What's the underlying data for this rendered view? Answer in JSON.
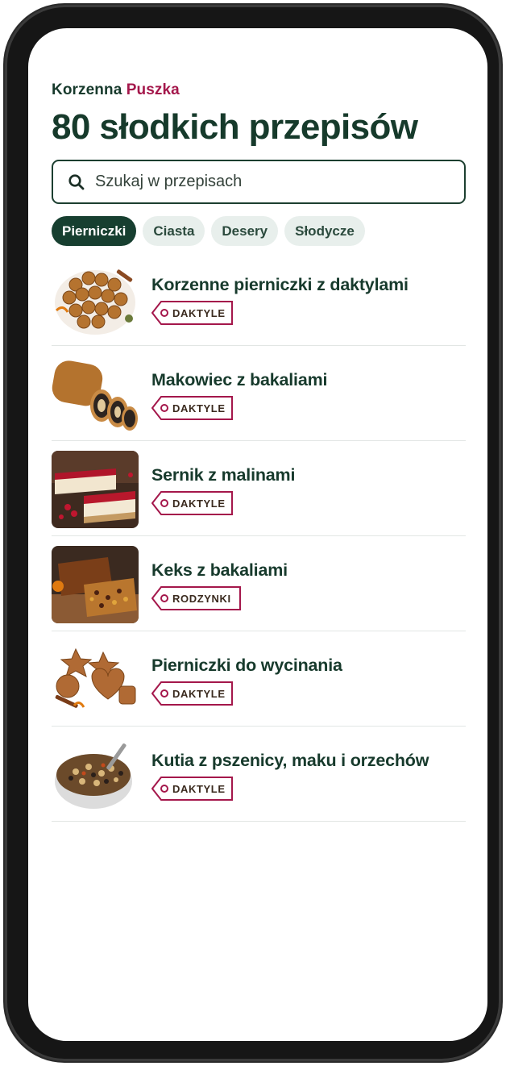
{
  "brand": {
    "first": "Korzenna",
    "second": "Puszka"
  },
  "page_title": "80 słodkich przepisów",
  "search": {
    "placeholder": "Szukaj w przepisach",
    "icon": "search-icon"
  },
  "categories": [
    {
      "label": "Pierniczki",
      "active": true
    },
    {
      "label": "Ciasta",
      "active": false
    },
    {
      "label": "Desery",
      "active": false
    },
    {
      "label": "Słodycze",
      "active": false
    }
  ],
  "recipes": [
    {
      "title": "Korzenne pierniczki z daktylami",
      "tag": "DAKTYLE"
    },
    {
      "title": "Makowiec z bakaliami",
      "tag": "DAKTYLE"
    },
    {
      "title": "Sernik z malinami",
      "tag": "DAKTYLE"
    },
    {
      "title": "Keks z bakaliami",
      "tag": "RODZYNKI"
    },
    {
      "title": "Pierniczki do wycinania",
      "tag": "DAKTYLE"
    },
    {
      "title": "Kutia z pszenicy, maku i orzechów",
      "tag": "DAKTYLE"
    }
  ],
  "colors": {
    "primary": "#173f30",
    "accent": "#a4174b",
    "chip_bg": "#e8efec"
  }
}
